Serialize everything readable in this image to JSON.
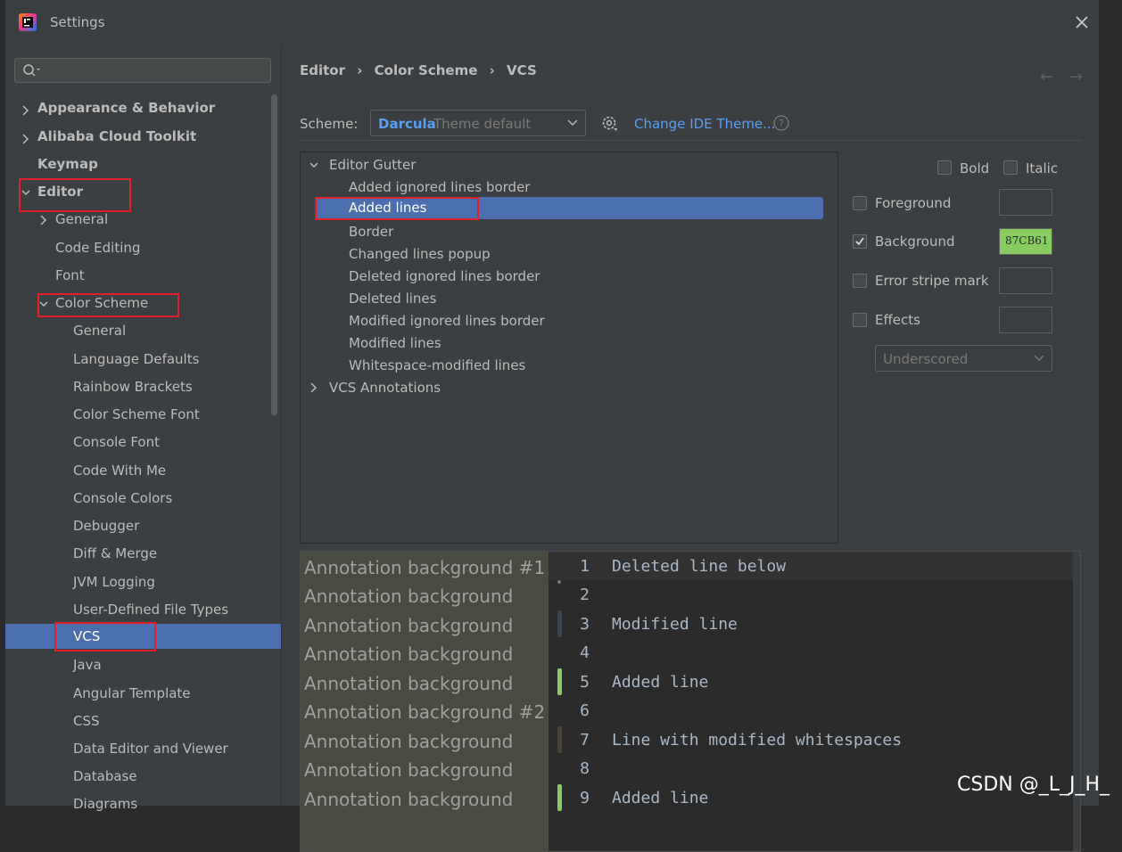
{
  "window": {
    "title": "Settings"
  },
  "search": {
    "placeholder": ""
  },
  "sidebar": {
    "items": [
      {
        "label": "Appearance & Behavior"
      },
      {
        "label": "Alibaba Cloud Toolkit"
      },
      {
        "label": "Keymap"
      },
      {
        "label": "Editor"
      },
      {
        "label": "General"
      },
      {
        "label": "Code Editing"
      },
      {
        "label": "Font"
      },
      {
        "label": "Color Scheme"
      },
      {
        "label": "General"
      },
      {
        "label": "Language Defaults"
      },
      {
        "label": "Rainbow Brackets"
      },
      {
        "label": "Color Scheme Font"
      },
      {
        "label": "Console Font"
      },
      {
        "label": "Code With Me"
      },
      {
        "label": "Console Colors"
      },
      {
        "label": "Debugger"
      },
      {
        "label": "Diff & Merge"
      },
      {
        "label": "JVM Logging"
      },
      {
        "label": "User-Defined File Types"
      },
      {
        "label": "VCS"
      },
      {
        "label": "Java"
      },
      {
        "label": "Angular Template"
      },
      {
        "label": "CSS"
      },
      {
        "label": "Data Editor and Viewer"
      },
      {
        "label": "Database"
      },
      {
        "label": "Diagrams"
      }
    ]
  },
  "breadcrumb": [
    "Editor",
    "Color Scheme",
    "VCS"
  ],
  "scheme": {
    "label": "Scheme:",
    "name": "Darcula",
    "sub": "Theme default",
    "change_link": "Change IDE Theme..."
  },
  "tree": {
    "group1": "Editor Gutter",
    "items": [
      "Added ignored lines border",
      "Added lines",
      "Border",
      "Changed lines popup",
      "Deleted ignored lines border",
      "Deleted lines",
      "Modified ignored lines border",
      "Modified lines",
      "Whitespace-modified lines"
    ],
    "group2": "VCS Annotations"
  },
  "attributes": {
    "bold": "Bold",
    "italic": "Italic",
    "foreground": "Foreground",
    "background": "Background",
    "background_color": "87CB61",
    "error_stripe": "Error stripe mark",
    "effects": "Effects",
    "effects_type": "Underscored"
  },
  "colors": {
    "accent": "#589df6",
    "selection": "#4b6eaf",
    "added": "#87CB61",
    "highlight_box": "#e0202a"
  },
  "preview": {
    "annotations": [
      "Annotation background #1",
      "Annotation background",
      "Annotation background",
      "Annotation background",
      "Annotation background",
      "Annotation background #2",
      "Annotation background",
      "Annotation background",
      "Annotation background"
    ],
    "line_numbers": [
      "1",
      "2",
      "3",
      "4",
      "5",
      "6",
      "7",
      "8",
      "9"
    ],
    "code": [
      "Deleted line below",
      "",
      "Modified line",
      "",
      "Added line",
      "",
      "Line with modified whitespaces",
      "",
      "Added line"
    ]
  },
  "watermark": "CSDN @_L_J_H_"
}
